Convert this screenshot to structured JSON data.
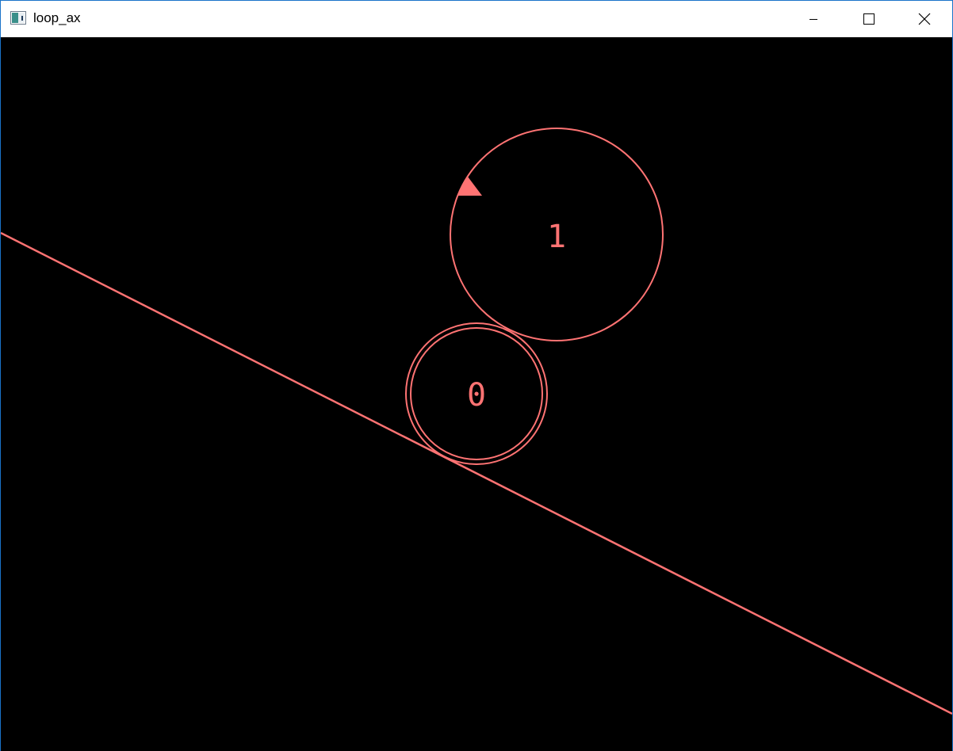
{
  "window": {
    "title": "loop_ax",
    "app_icon": "python-window-icon",
    "controls": {
      "minimize_icon": "minimize-icon",
      "maximize_icon": "maximize-icon",
      "close_icon": "close-icon"
    }
  },
  "scene": {
    "background_color": "#000000",
    "draw_color": "#ff7373",
    "ground_line": {
      "name": "ground-line"
    },
    "bodies": [
      {
        "label": "0",
        "shape": "double-ring circle"
      },
      {
        "label": "1",
        "shape": "circle with direction marker"
      }
    ]
  }
}
